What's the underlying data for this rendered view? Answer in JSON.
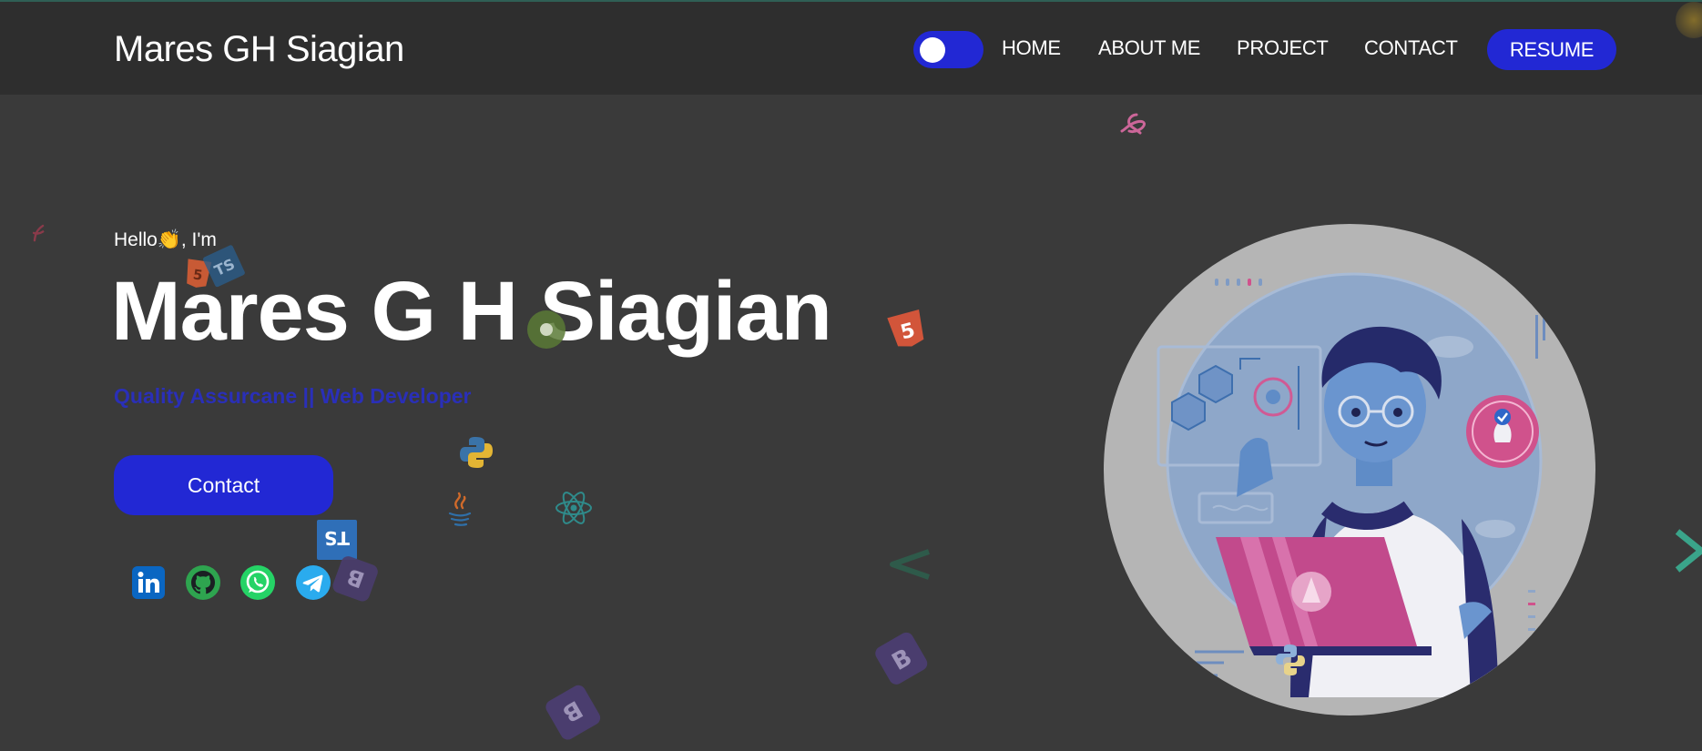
{
  "header": {
    "brand": "Mares GH Siagian",
    "nav": [
      "HOME",
      "ABOUT ME",
      "PROJECT",
      "CONTACT"
    ],
    "resume_label": "RESUME",
    "theme_toggle_on": true
  },
  "hero": {
    "greeting_prefix": "Hello",
    "greeting_suffix": ", I'm",
    "name": "Mares G H Siagian",
    "role": "Quality Assurcane || Web Developer",
    "contact_label": "Contact"
  },
  "social": [
    "linkedin-icon",
    "github-icon",
    "whatsapp-icon",
    "telegram-icon"
  ],
  "floating_icons": [
    "sass-icon",
    "html5-icon",
    "typescript-icon",
    "python-icon",
    "java-icon",
    "react-icon",
    "bootstrap-icon",
    "vue-icon",
    "gulp-icon"
  ],
  "colors": {
    "accent": "#2228d4",
    "background": "#3a3a3a",
    "navbar": "#2e2e2e",
    "role_text": "#2a2fb8",
    "hero_circle": "#b5b5b5"
  }
}
